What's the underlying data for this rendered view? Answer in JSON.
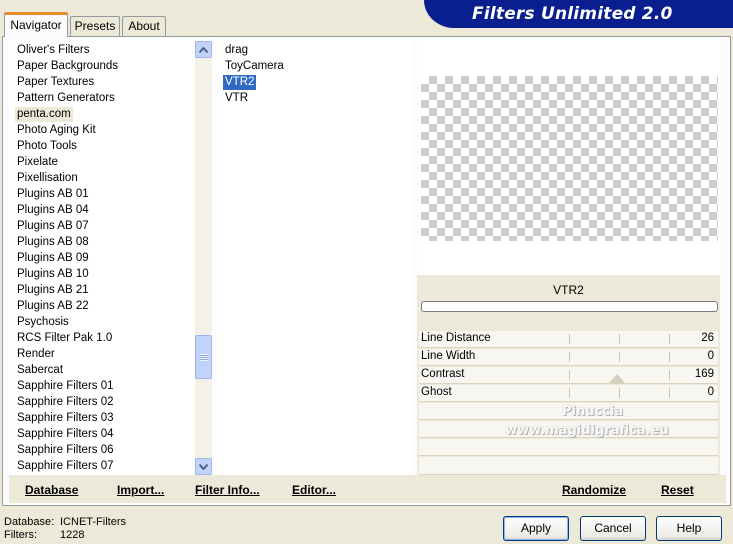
{
  "tabs": [
    {
      "label": "Navigator"
    },
    {
      "label": "Presets"
    },
    {
      "label": "About"
    }
  ],
  "banner": {
    "title": "Filters Unlimited 2.0"
  },
  "categories": {
    "items": [
      "Oliver's Filters",
      "Paper Backgrounds",
      "Paper Textures",
      "Pattern Generators",
      "penta.com",
      "Photo Aging Kit",
      "Photo Tools",
      "Pixelate",
      "Pixellisation",
      "Plugins AB 01",
      "Plugins AB 04",
      "Plugins AB 07",
      "Plugins AB 08",
      "Plugins AB 09",
      "Plugins AB 10",
      "Plugins AB 21",
      "Plugins AB 22",
      "Psychosis",
      "RCS Filter Pak 1.0",
      "Render",
      "Sabercat",
      "Sapphire Filters 01",
      "Sapphire Filters 02",
      "Sapphire Filters 03",
      "Sapphire Filters 04",
      "Sapphire Filters 06",
      "Sapphire Filters 07"
    ],
    "selected": "penta.com"
  },
  "filters": {
    "items": [
      "drag",
      "ToyCamera",
      "VTR2",
      "VTR"
    ],
    "selected": "VTR2"
  },
  "preview": {
    "filter_name": "VTR2"
  },
  "params": [
    {
      "label": "Line Distance",
      "value": "26"
    },
    {
      "label": "Line Width",
      "value": "0"
    },
    {
      "label": "Contrast",
      "value": "169"
    },
    {
      "label": "Ghost",
      "value": "0"
    }
  ],
  "watermark": {
    "line1": "Pinuccia",
    "line2": "www.magidigrafica.eu"
  },
  "bottom_links": {
    "database": "Database",
    "import": "Import...",
    "filter_info": "Filter Info...",
    "editor": "Editor...",
    "randomize": "Randomize",
    "reset": "Reset"
  },
  "footer": {
    "database_label": "Database:",
    "database_value": "ICNET-Filters",
    "filters_label": "Filters:",
    "filters_value": "1228"
  },
  "buttons": {
    "apply": "Apply",
    "cancel": "Cancel",
    "help": "Help"
  },
  "colors": {
    "banner": "#0a1f8f",
    "selection": "#316ac5",
    "tab_accent": "#e68b2c"
  }
}
